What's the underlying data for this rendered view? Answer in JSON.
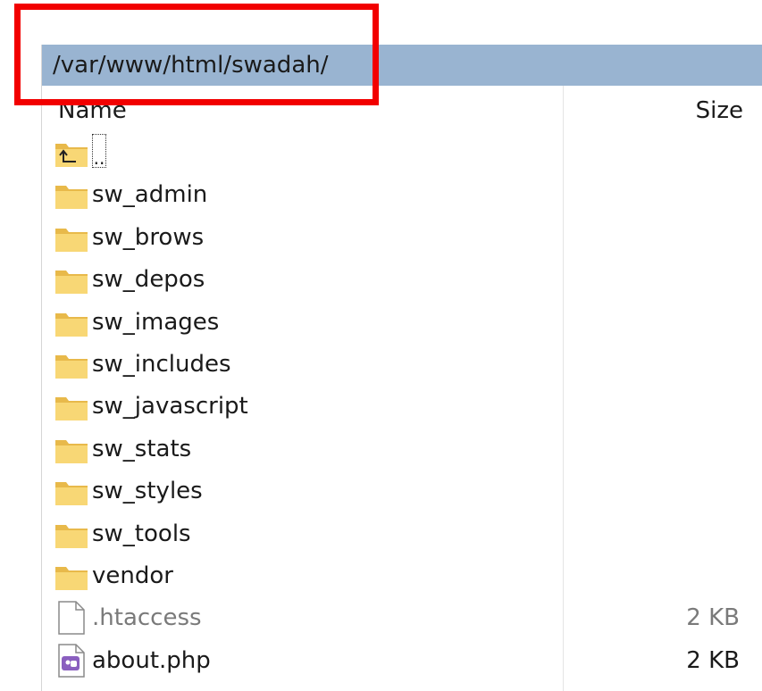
{
  "path_bar": {
    "path": "/var/www/html/swadah/"
  },
  "columns": {
    "name": "Name",
    "size": "Size"
  },
  "parent_entry": {
    "label": ".."
  },
  "folders": [
    {
      "name": "sw_admin"
    },
    {
      "name": "sw_brows"
    },
    {
      "name": "sw_depos"
    },
    {
      "name": "sw_images"
    },
    {
      "name": "sw_includes"
    },
    {
      "name": "sw_javascript"
    },
    {
      "name": "sw_stats"
    },
    {
      "name": "sw_styles"
    },
    {
      "name": "sw_tools"
    },
    {
      "name": "vendor"
    }
  ],
  "files": [
    {
      "name": ".htaccess",
      "size": "2 KB",
      "icon": "document-icon",
      "hidden": true
    },
    {
      "name": "about.php",
      "size": "2 KB",
      "icon": "php-file-icon",
      "hidden": false
    }
  ],
  "colors": {
    "path_bar_bg": "#99b4d1",
    "folder_yellow": "#f8d775",
    "highlight_red": "#f20000",
    "php_purple": "#8a5fbf"
  }
}
